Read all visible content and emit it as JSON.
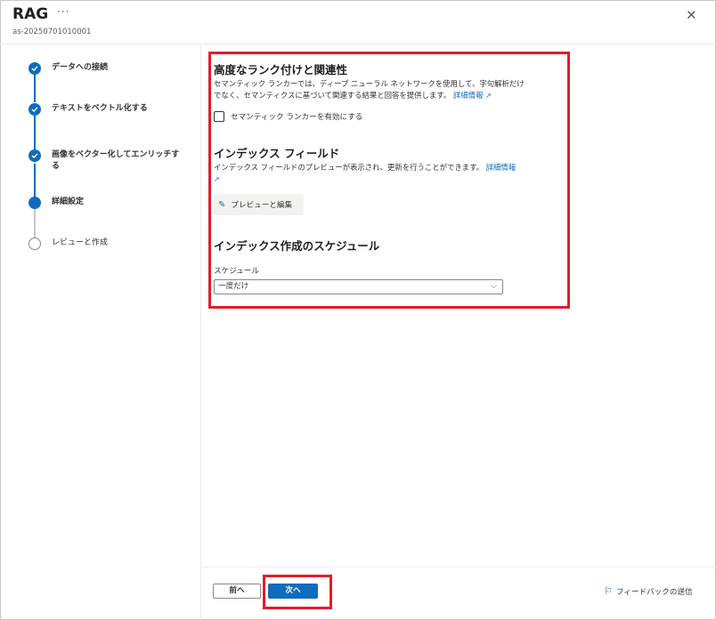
{
  "header": {
    "title": "RAG",
    "more": "···",
    "subtitle": "as-20250701010001",
    "close": "✕"
  },
  "steps": [
    {
      "label": "データへの接続",
      "state": "done"
    },
    {
      "label": "テキストをベクトル化する",
      "state": "done"
    },
    {
      "label": "画像をベクター化してエンリッチする",
      "state": "done"
    },
    {
      "label": "詳細設定",
      "state": "current"
    },
    {
      "label": "レビューと作成",
      "state": "todo"
    }
  ],
  "ranking": {
    "title": "高度なランク付けと関連性",
    "desc_line1": "セマンティック ランカーでは、ディープ ニューラル ネットワークを使用して、字句解析だけ",
    "desc_line2": "でなく、セマンティクスに基づいて関連する結果と回答を提供します。",
    "link": "詳細情報",
    "checkbox_label": "セマンティック ランカーを有効にする"
  },
  "index_fields": {
    "title": "インデックス フィールド",
    "desc": "インデックス フィールドのプレビューが表示され、更新を行うことができます。",
    "link": "詳細情報",
    "preview_button": "プレビューと編集"
  },
  "schedule": {
    "title": "インデックス作成のスケジュール",
    "field_label": "スケジュール",
    "selected": "一度だけ"
  },
  "footer": {
    "prev": "前へ",
    "next": "次へ",
    "feedback": "フィードバックの送信"
  },
  "colors": {
    "accent": "#0f6cbd",
    "highlight": "#e01e2a"
  }
}
